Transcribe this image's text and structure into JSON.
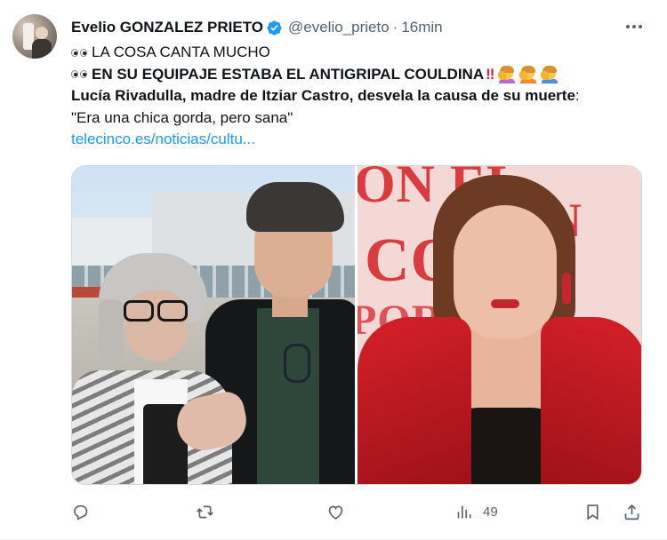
{
  "tweet": {
    "author_name": "Evelio GONZALEZ PRIETO",
    "handle": "@evelio_prieto",
    "separator": "·",
    "time": "16min",
    "line1": "LA COSA CANTA MUCHO",
    "line2": "EN SU EQUIPAJE ESTABA EL ANTIGRIPAL COULDINA",
    "line2_marks": "!!",
    "line3_bold": "Lucía Rivadulla, madre de Itziar Castro, desvela la causa de su muerte",
    "line3_colon": ":",
    "line4": "\"Era una chica gorda, pero sana\"",
    "link_text": "telecinco.es/noticias/cultu...",
    "poster_text": [
      "ON EL",
      "COR",
      "POR",
      "ON"
    ]
  },
  "actions": {
    "views_count": "49"
  },
  "icons": {
    "verified": "verified-badge-icon",
    "more": "more-icon",
    "reply": "reply-icon",
    "retweet": "retweet-icon",
    "like": "like-icon",
    "views": "views-icon",
    "bookmark": "bookmark-icon",
    "share": "share-icon"
  },
  "colors": {
    "accent": "#1d9bf0",
    "text": "#0f1419",
    "secondary": "#536471",
    "marks": "#d21f3c"
  }
}
